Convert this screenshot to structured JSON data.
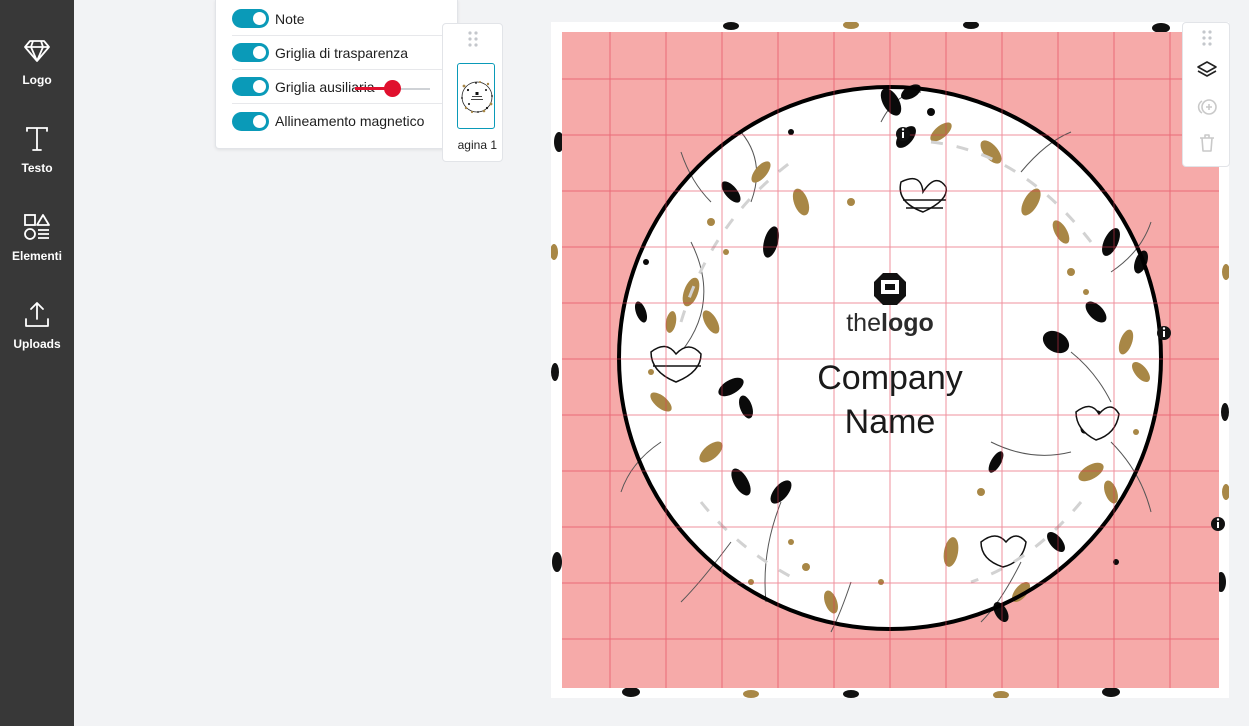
{
  "sidebar": {
    "items": [
      {
        "label": "Logo",
        "icon": "diamond-icon"
      },
      {
        "label": "Testo",
        "icon": "text-icon"
      },
      {
        "label": "Elementi",
        "icon": "shapes-icon"
      },
      {
        "label": "Uploads",
        "icon": "upload-icon"
      }
    ]
  },
  "settings": {
    "items": [
      {
        "label": "Note",
        "enabled": true
      },
      {
        "label": "Griglia di trasparenza",
        "enabled": true
      },
      {
        "label": "Griglia ausiliaria",
        "enabled": true
      },
      {
        "label": "Allineamento magnetico",
        "enabled": true
      }
    ],
    "grid_slider": {
      "value": 0.5
    }
  },
  "pages": {
    "thumbnail_label": "agina 1"
  },
  "design": {
    "logo_text_light": "the",
    "logo_text_bold": "logo",
    "company_line1": "Company",
    "company_line2": "Name"
  },
  "tools": {
    "items": [
      {
        "icon": "layers-icon",
        "enabled": true
      },
      {
        "icon": "duplicate-icon",
        "enabled": false
      },
      {
        "icon": "trash-icon",
        "enabled": false
      }
    ]
  },
  "colors": {
    "sidebar_bg": "#383838",
    "accent_toggle": "#0a9ab8",
    "slider_red": "#e0102e",
    "transparency_overlay": "#f6aaa9",
    "grid_line": "#e2374f",
    "leaf_gold": "#a88746",
    "leaf_black": "#000000"
  }
}
